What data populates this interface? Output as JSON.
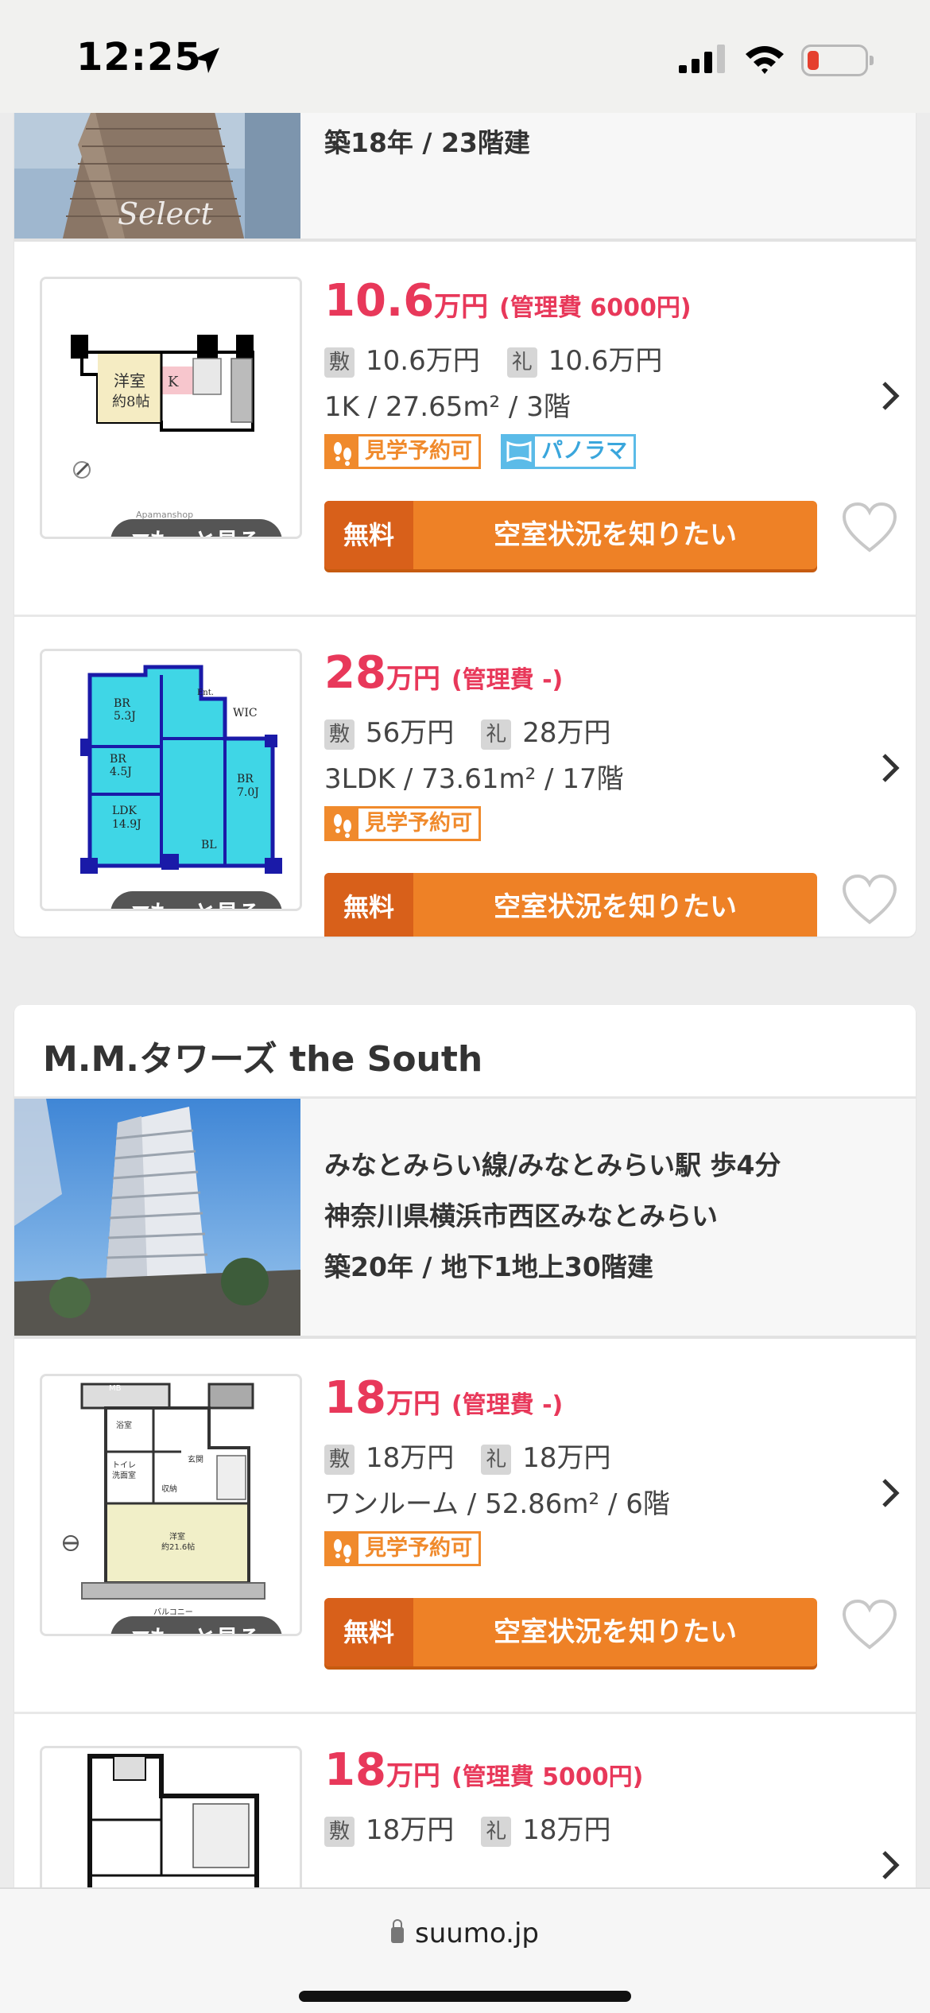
{
  "status_bar": {
    "time": "12:25"
  },
  "top_building": {
    "info_line": "築18年 / 23階建",
    "photo_watermark": "Select"
  },
  "listings_a": [
    {
      "price": "10.6",
      "price_unit": "万円",
      "management": "(管理費 6000円)",
      "deposit_label": "敷",
      "deposit": "10.6万円",
      "key_money_label": "礼",
      "key_money": "10.6万円",
      "layout": "1K",
      "area": "27.65m²",
      "floor": "3階",
      "badges": [
        "見学予約可",
        "パノラマ"
      ],
      "more_label": "▼もっと見る",
      "free_label": "無料",
      "cta_label": "空室状況を知りたい",
      "plan_labels": {
        "room": "洋室",
        "size": "約8帖",
        "k": "K",
        "credit": "Apamanshop"
      }
    },
    {
      "price": "28",
      "price_unit": "万円",
      "management": "(管理費 -)",
      "deposit_label": "敷",
      "deposit": "56万円",
      "key_money_label": "礼",
      "key_money": "28万円",
      "layout": "3LDK",
      "area": "73.61m²",
      "floor": "17階",
      "badges": [
        "見学予約可"
      ],
      "more_label": "▼もっと見る",
      "free_label": "無料",
      "cta_label": "空室状況を知りたい",
      "plan_labels": {
        "br1": "BR",
        "br1s": "5.3J",
        "br2": "BR",
        "br2s": "4.5J",
        "ldk": "LDK",
        "ldks": "14.9J",
        "br3": "BR",
        "br3s": "7.0J",
        "wic": "WIC",
        "bl": "BL",
        "ent": "Ent."
      }
    }
  ],
  "building_b": {
    "name": "M.M.タワーズ the South",
    "access": "みなとみらい線/みなとみらい駅 歩4分",
    "address": "神奈川県横浜市西区みなとみらい",
    "age": "築20年 / 地下1地上30階建"
  },
  "listings_b": [
    {
      "price": "18",
      "price_unit": "万円",
      "management": "(管理費 -)",
      "deposit_label": "敷",
      "deposit": "18万円",
      "key_money_label": "礼",
      "key_money": "18万円",
      "layout": "ワンルーム",
      "area": "52.86m²",
      "floor": "6階",
      "badges": [
        "見学予約可"
      ],
      "more_label": "▼もっと見る",
      "free_label": "無料",
      "cta_label": "空室状況を知りたい",
      "plan_labels": {
        "mb": "MB",
        "bath": "浴室",
        "toilet": "トイレ",
        "wash": "洗面室",
        "ent": "玄関",
        "storage": "収納",
        "room": "洋室",
        "roomsize": "約21.6帖",
        "balcony": "バルコニー"
      }
    },
    {
      "price": "18",
      "price_unit": "万円",
      "management": "(管理費 5000円)",
      "deposit_label": "敷",
      "deposit": "18万円",
      "key_money_label": "礼",
      "key_money": "18万円"
    }
  ],
  "bottom_bar": {
    "url": "suumo.jp"
  },
  "colors": {
    "price": "#e8385a",
    "cta": "#ee8126",
    "cta_free": "#d8601a",
    "badge_orange": "#f08a2c",
    "badge_blue": "#5bbbe8"
  }
}
